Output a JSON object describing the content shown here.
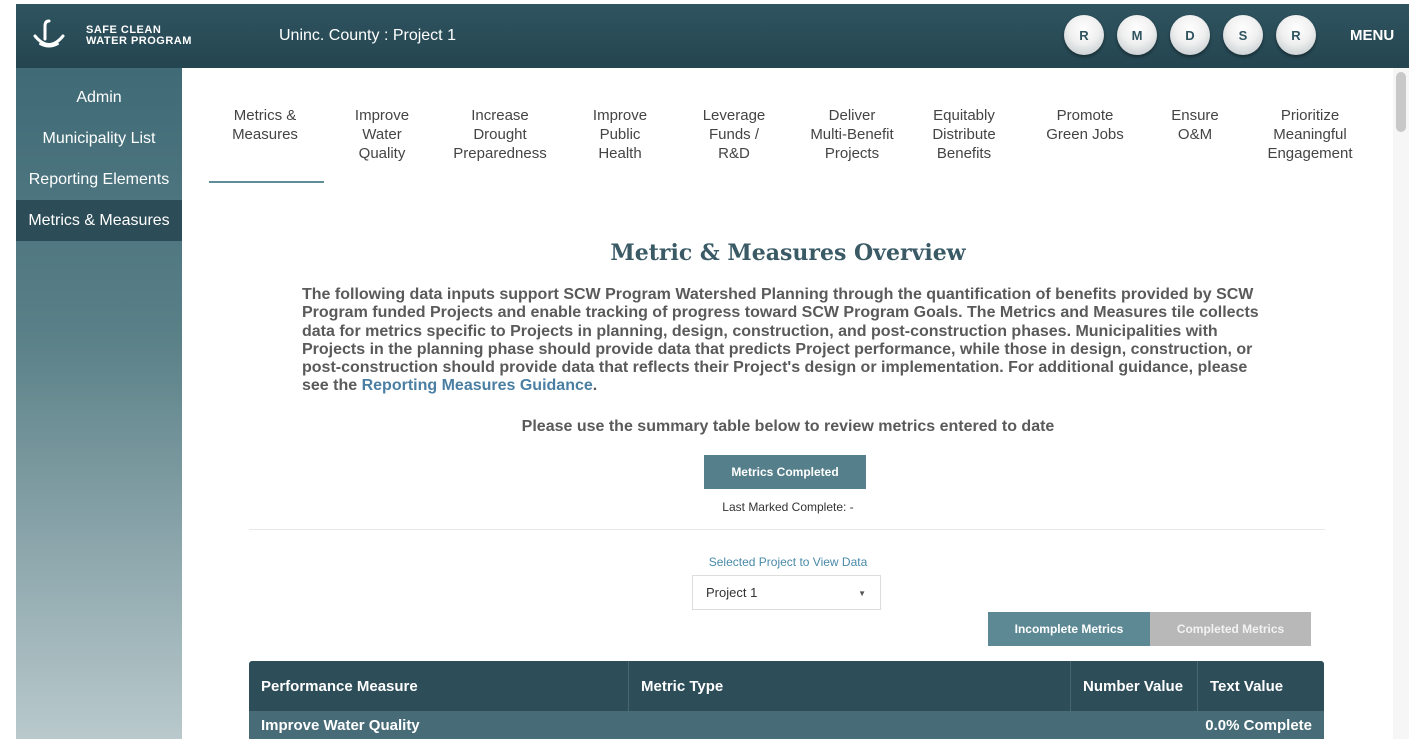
{
  "header": {
    "logo_line1": "SAFE CLEAN",
    "logo_line2": "WATER PROGRAM",
    "breadcrumb": "Uninc. County : Project 1",
    "avatars": [
      "R",
      "M",
      "D",
      "S",
      "R"
    ],
    "menu_label": "MENU"
  },
  "sidebar": {
    "items": [
      {
        "label": "Admin"
      },
      {
        "label": "Municipality List"
      },
      {
        "label": "Reporting Elements"
      },
      {
        "label": "Metrics & Measures"
      }
    ]
  },
  "tabs": [
    {
      "label": "Metrics &\nMeasures"
    },
    {
      "label": "Improve\nWater\nQuality"
    },
    {
      "label": "Increase\nDrought\nPreparedness"
    },
    {
      "label": "Improve\nPublic\nHealth"
    },
    {
      "label": "Leverage\nFunds /\nR&D"
    },
    {
      "label": "Deliver\nMulti-Benefit\nProjects"
    },
    {
      "label": "Equitably\nDistribute\nBenefits"
    },
    {
      "label": "Promote\nGreen Jobs"
    },
    {
      "label": "Ensure\nO&M"
    },
    {
      "label": "Prioritize\nMeaningful\nEngagement"
    }
  ],
  "overview": {
    "title": "Metric & Measures Overview",
    "intro_text": "The following data inputs support SCW Program Watershed Planning through the quantification of benefits provided by SCW Program funded Projects and enable tracking of progress toward SCW Program Goals. The Metrics and Measures tile collects data for metrics specific to Projects in planning, design, construction, and post-construction phases. Municipalities with Projects in the planning phase should provide data that predicts Project performance, while those in design, construction, or post-construction should provide data that reflects their Project's design or implementation. For additional guidance, please see the ",
    "guidance_link": "Reporting Measures Guidance",
    "intro_end": ".",
    "instruction": "Please use the summary table below to review metrics entered to date",
    "metrics_completed_button": "Metrics Completed",
    "last_marked": "Last Marked Complete:  -"
  },
  "project_select": {
    "label": "Selected Project to View Data",
    "value": "Project 1"
  },
  "toggle": {
    "incomplete": "Incomplete Metrics",
    "completed": "Completed Metrics"
  },
  "table": {
    "headers": [
      "Performance Measure",
      "Metric Type",
      "Number Value",
      "Text Value"
    ],
    "group": {
      "name": "Improve Water Quality",
      "status": "0.0% Complete"
    }
  }
}
